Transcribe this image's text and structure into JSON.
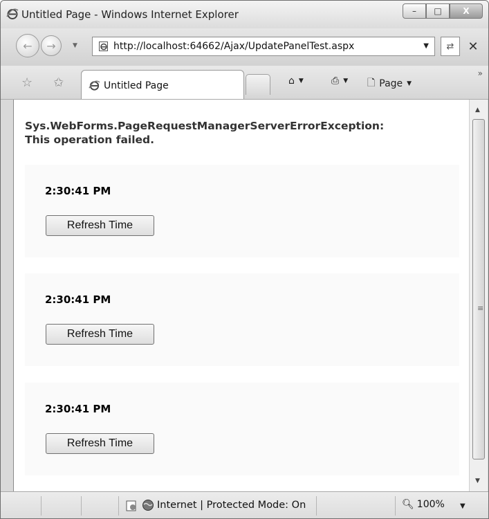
{
  "window": {
    "title": "Untitled Page - Windows Internet Explorer",
    "minimize": "–",
    "maximize": "□",
    "close": "X"
  },
  "address_bar": {
    "url": "http://localhost:64662/Ajax/UpdatePanelTest.aspx"
  },
  "tab": {
    "label": "Untitled Page"
  },
  "command_bar": {
    "page_label": "Page"
  },
  "page": {
    "error_line1": "Sys.WebForms.PageRequestManagerServerErrorException:",
    "error_line2": "This operation failed.",
    "panels": [
      {
        "time": "2:30:41 PM",
        "button": "Refresh Time"
      },
      {
        "time": "2:30:41 PM",
        "button": "Refresh Time"
      },
      {
        "time": "2:30:41 PM",
        "button": "Refresh Time"
      }
    ]
  },
  "status_bar": {
    "zone": "Internet | Protected Mode: On",
    "zoom": "100%"
  },
  "colors": {
    "panel_background": "#fafafa",
    "error_text": "#333333"
  }
}
